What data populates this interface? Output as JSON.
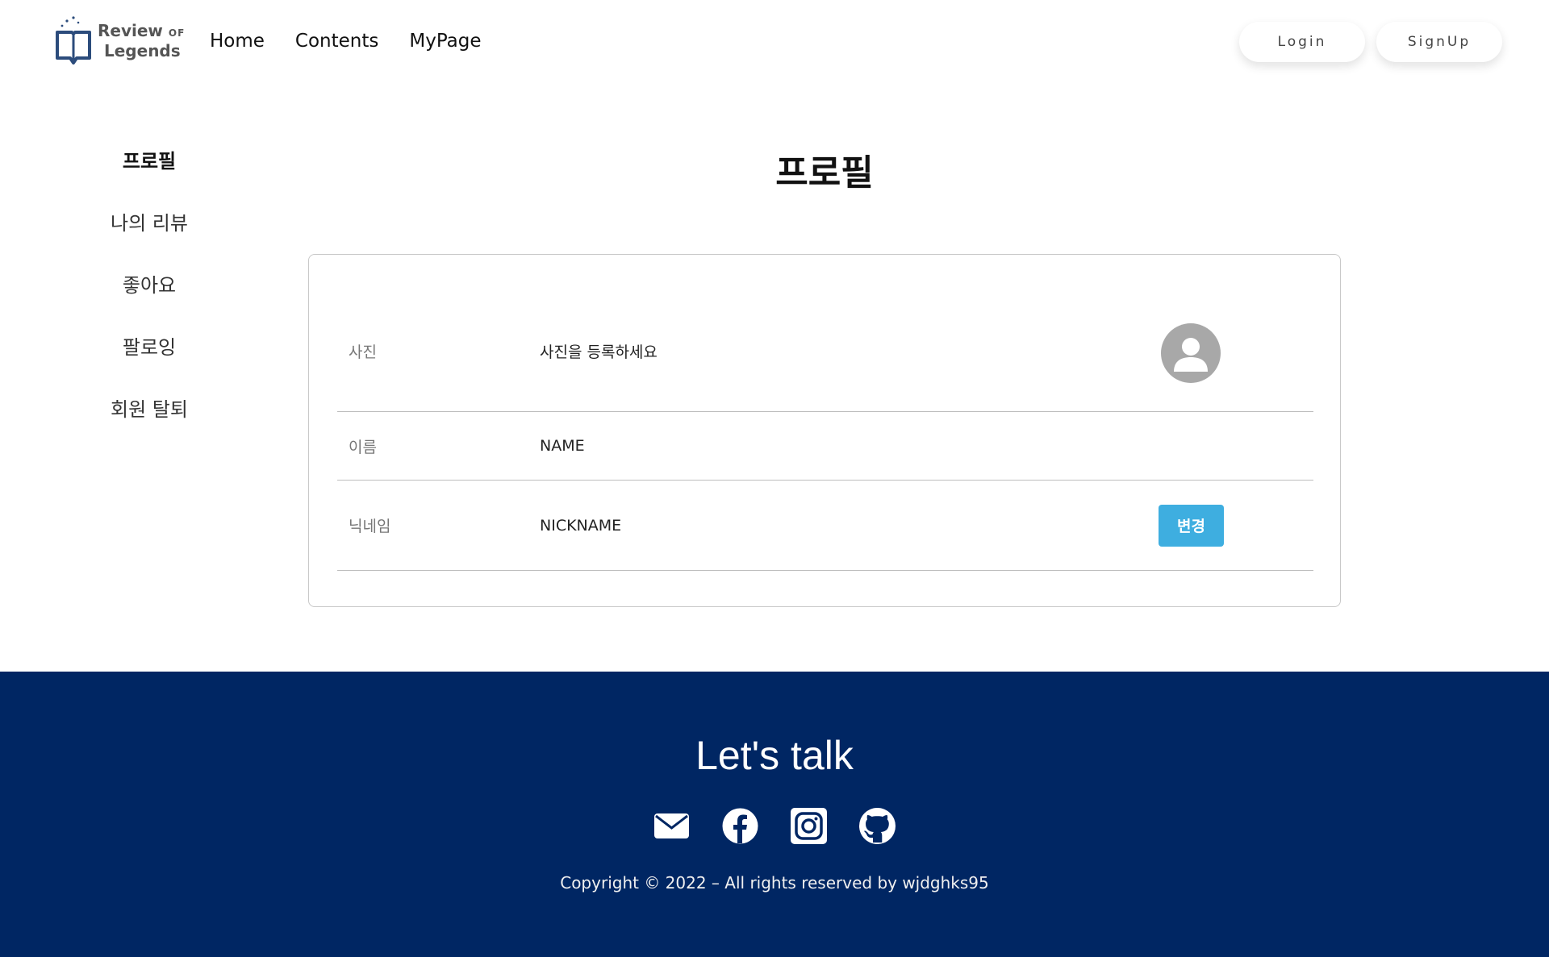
{
  "header": {
    "logo": {
      "line1": "Review",
      "of": "OF",
      "line2": "Legends"
    },
    "nav": [
      {
        "label": "Home"
      },
      {
        "label": "Contents"
      },
      {
        "label": "MyPage"
      }
    ],
    "login_label": "Login",
    "signup_label": "SignUp"
  },
  "sidebar": {
    "items": [
      {
        "label": "프로필",
        "active": true
      },
      {
        "label": "나의 리뷰"
      },
      {
        "label": "좋아요"
      },
      {
        "label": "팔로잉"
      },
      {
        "label": "회원 탈퇴"
      }
    ]
  },
  "main": {
    "title": "프로필",
    "rows": {
      "photo": {
        "label": "사진",
        "value": "사진을 등록하세요"
      },
      "name": {
        "label": "이름",
        "value": "NAME"
      },
      "nickname": {
        "label": "닉네임",
        "value": "NICKNAME",
        "button": "변경"
      }
    }
  },
  "footer": {
    "title": "Let's talk",
    "icons": [
      "mail-icon",
      "facebook-icon",
      "instagram-icon",
      "github-icon"
    ],
    "copyright": "Copyright © 2022 – All rights reserved by wjdghks95"
  },
  "colors": {
    "footer_bg": "#002663",
    "accent_button": "#3eaee0",
    "avatar_gray": "#a8a8a8"
  }
}
